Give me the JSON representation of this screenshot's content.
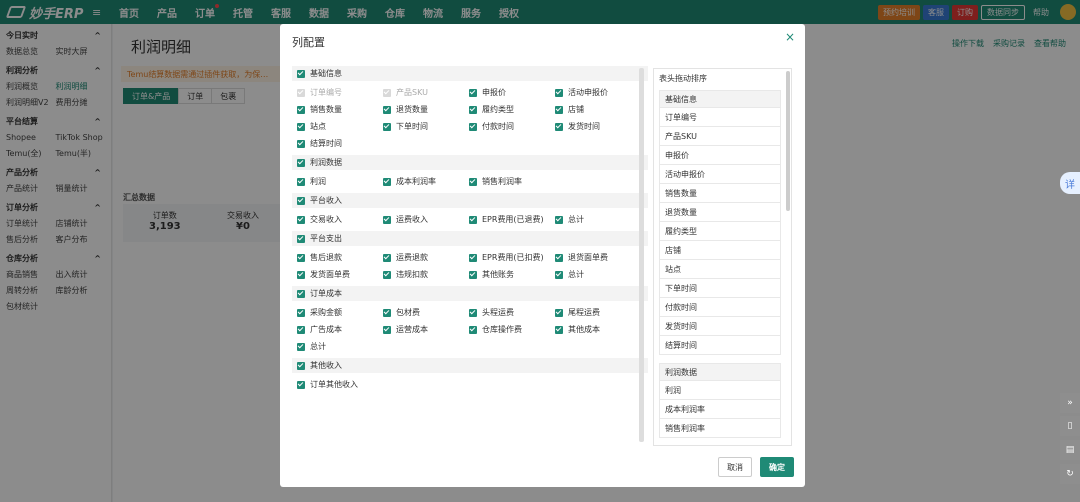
{
  "app": {
    "logo": "妙手ERP",
    "menu_icon": "≡"
  },
  "nav": [
    "首页",
    "产品",
    "订单",
    "托管",
    "客服",
    "数据",
    "采购",
    "仓库",
    "物流",
    "服务",
    "授权"
  ],
  "topright": {
    "reserve": "预约培训",
    "service": "客服",
    "order": "订购",
    "sync": "数据同步",
    "help": "帮助"
  },
  "sidebar": [
    {
      "section": "今日实时",
      "items": [
        [
          "数据总览",
          "实时大屏"
        ]
      ]
    },
    {
      "section": "利润分析",
      "items": [
        [
          "利润概览",
          "利润明细"
        ],
        [
          "利润明细V2",
          "费用分摊"
        ]
      ]
    },
    {
      "section": "平台结算",
      "items": [
        [
          "Shopee",
          "TikTok Shop"
        ],
        [
          "Temu(全)",
          "Temu(半)"
        ]
      ]
    },
    {
      "section": "产品分析",
      "items": [
        [
          "产品统计",
          "销量统计"
        ]
      ]
    },
    {
      "section": "订单分析",
      "items": [
        [
          "订单统计",
          "店铺统计"
        ],
        [
          "售后分析",
          "客户分布"
        ]
      ]
    },
    {
      "section": "仓库分析",
      "items": [
        [
          "商品销售",
          "出入统计"
        ],
        [
          "周转分析",
          "库龄分析"
        ],
        [
          "包材统计",
          ""
        ]
      ]
    }
  ],
  "page": {
    "title": "利润明细",
    "links": [
      "操作下载",
      "采购记录",
      "查看帮助"
    ],
    "notice": "Temu结算数据需通过插件获取，为保…",
    "tabs": [
      "订单&产品",
      "订单",
      "包裹"
    ],
    "stat_label": "汇总数据",
    "stats": [
      {
        "label": "订单数",
        "value": "3,193"
      },
      {
        "label": "交易收入",
        "value": "¥0"
      }
    ]
  },
  "dialog": {
    "title": "列配置",
    "close": "×",
    "groups": [
      {
        "name": "基础信息",
        "items": [
          {
            "label": "订单编号",
            "disabled": true
          },
          {
            "label": "产品SKU",
            "disabled": true
          },
          {
            "label": "申报价"
          },
          {
            "label": "活动申报价"
          },
          {
            "label": "销售数量"
          },
          {
            "label": "退货数量"
          },
          {
            "label": "履约类型"
          },
          {
            "label": "店铺"
          },
          {
            "label": "站点"
          },
          {
            "label": "下单时间"
          },
          {
            "label": "付款时间"
          },
          {
            "label": "发货时间"
          },
          {
            "label": "结算时间"
          }
        ]
      },
      {
        "name": "利润数据",
        "items": [
          {
            "label": "利润"
          },
          {
            "label": "成本利润率"
          },
          {
            "label": "销售利润率"
          }
        ]
      },
      {
        "name": "平台收入",
        "items": [
          {
            "label": "交易收入"
          },
          {
            "label": "运费收入"
          },
          {
            "label": "EPR费用(已退费)"
          },
          {
            "label": "总计"
          }
        ]
      },
      {
        "name": "平台支出",
        "items": [
          {
            "label": "售后退款"
          },
          {
            "label": "运费退款"
          },
          {
            "label": "EPR费用(已扣费)"
          },
          {
            "label": "退货面单费"
          },
          {
            "label": "发货面单费"
          },
          {
            "label": "违规扣款"
          },
          {
            "label": "其他账务"
          },
          {
            "label": "总计"
          }
        ]
      },
      {
        "name": "订单成本",
        "items": [
          {
            "label": "采购金额"
          },
          {
            "label": "包材费"
          },
          {
            "label": "头程运费"
          },
          {
            "label": "尾程运费"
          },
          {
            "label": "广告成本"
          },
          {
            "label": "运营成本"
          },
          {
            "label": "仓库操作费"
          },
          {
            "label": "其他成本"
          },
          {
            "label": "总计"
          }
        ]
      },
      {
        "name": "其他收入",
        "items": [
          {
            "label": "订单其他收入"
          }
        ]
      }
    ],
    "sort_title": "表头拖动排序",
    "sort_groups": [
      {
        "name": "基础信息",
        "items": [
          "订单编号",
          "产品SKU",
          "申报价",
          "活动申报价",
          "销售数量",
          "退货数量",
          "履约类型",
          "店铺",
          "站点",
          "下单时间",
          "付款时间",
          "发货时间",
          "结算时间"
        ]
      },
      {
        "name": "利润数据",
        "items": [
          "利润",
          "成本利润率",
          "销售利润率"
        ]
      }
    ],
    "cancel": "取消",
    "ok": "确定"
  },
  "colors": {
    "primary": "#1f8a76",
    "reserve": "#e6802b",
    "service": "#3a7bd5",
    "order": "#e53935"
  }
}
